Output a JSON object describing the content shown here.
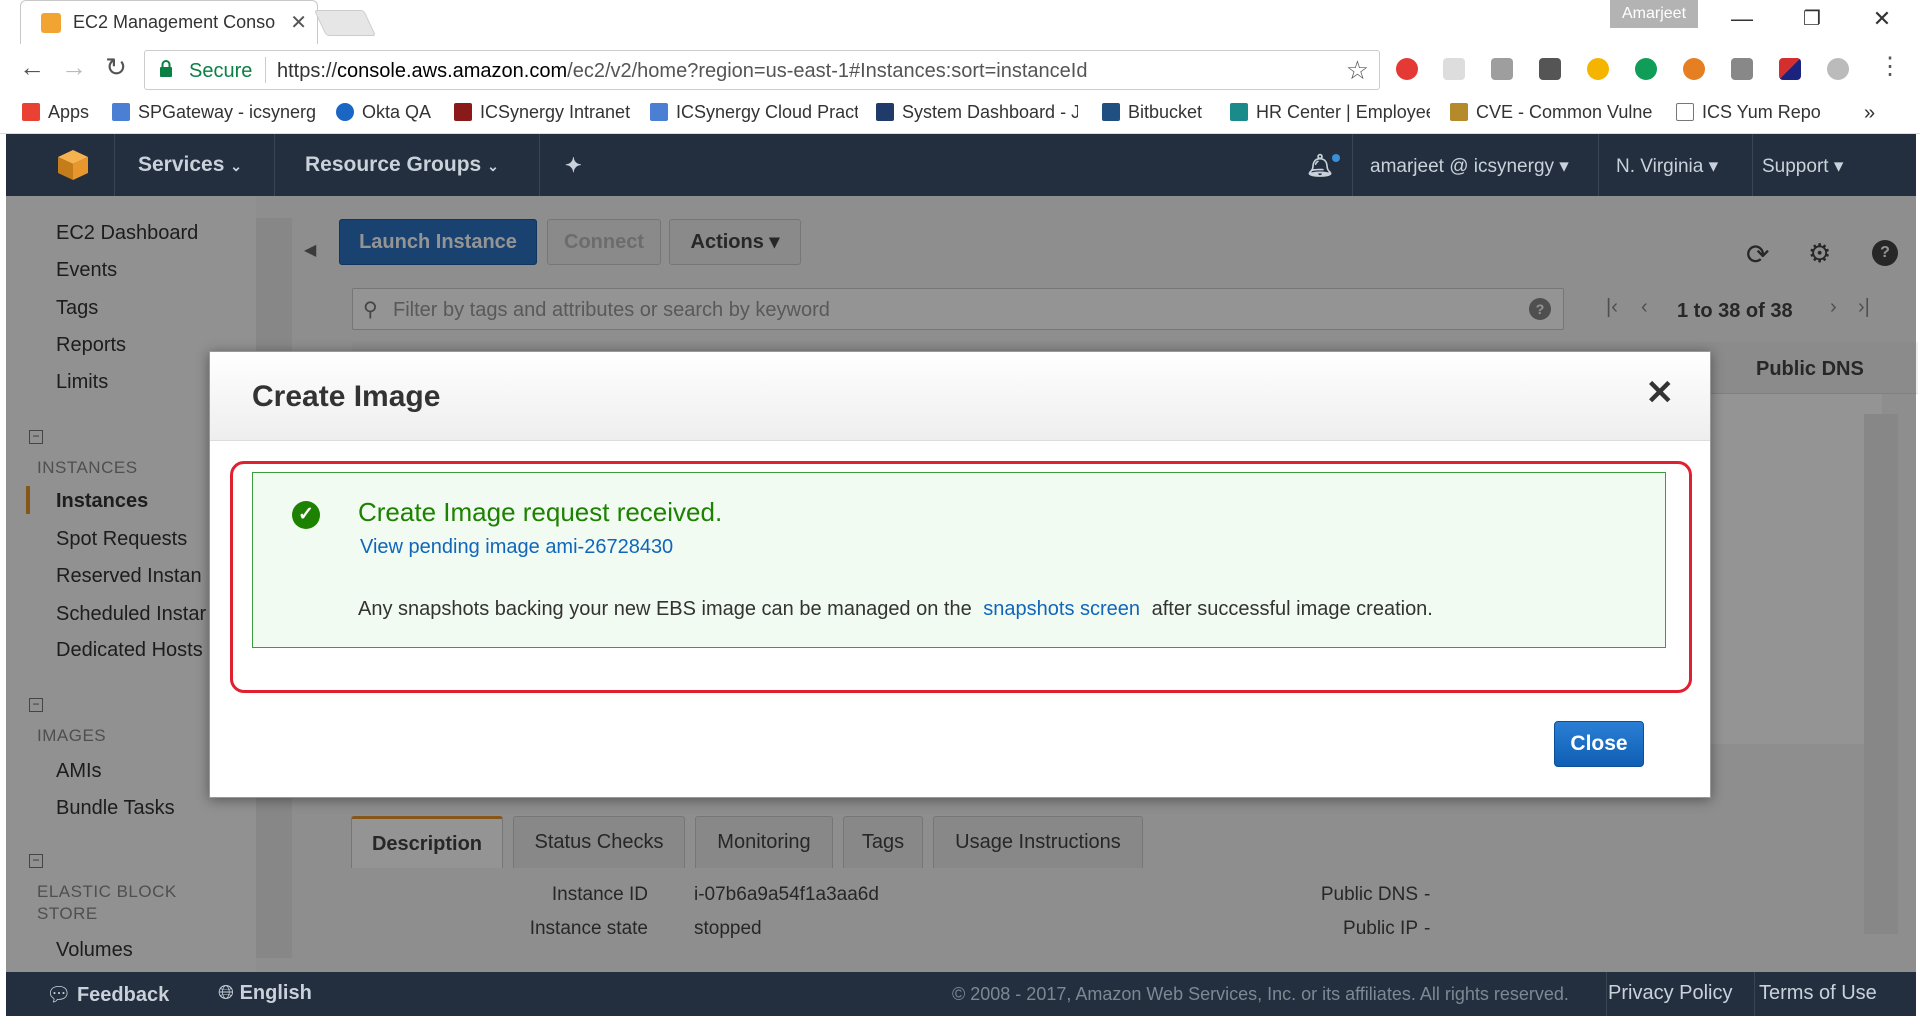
{
  "browser": {
    "tab_title": "EC2 Management Conso",
    "profile_name": "Amarjeet",
    "secure_label": "Secure",
    "url_scheme": "https://",
    "url_host": "console.aws.amazon.com",
    "url_path": "/ec2/v2/home?region=us-east-1#Instances:sort=instanceId"
  },
  "bookmarks": [
    {
      "label": "Apps",
      "color": "#e94235"
    },
    {
      "label": "SPGateway - icsynerg",
      "color": "#4a7fd4"
    },
    {
      "label": "Okta QA",
      "color": "#1a66c4"
    },
    {
      "label": "ICSynergy Intranet",
      "color": "#8a1a1a"
    },
    {
      "label": "ICSynergy Cloud Pract",
      "color": "#4a7fd4"
    },
    {
      "label": "System Dashboard - J",
      "color": "#203a6a"
    },
    {
      "label": "Bitbucket",
      "color": "#205081"
    },
    {
      "label": "HR Center | Employee",
      "color": "#1a8a8a"
    },
    {
      "label": "CVE - Common Vulne",
      "color": "#b58a2a"
    },
    {
      "label": "ICS Yum Repo",
      "color": "#777777"
    }
  ],
  "aws_header": {
    "services": "Services",
    "resource_groups": "Resource Groups",
    "user": "amarjeet @ icsynergy",
    "region": "N. Virginia",
    "support": "Support"
  },
  "sidebar": {
    "top_items": [
      "EC2 Dashboard",
      "Events",
      "Tags",
      "Reports",
      "Limits"
    ],
    "instances_heading": "INSTANCES",
    "instances_items": [
      "Instances",
      "Spot Requests",
      "Reserved Instan",
      "Scheduled Instar",
      "Dedicated Hosts"
    ],
    "images_heading": "IMAGES",
    "images_items": [
      "AMIs",
      "Bundle Tasks"
    ],
    "ebs_heading_line1": "ELASTIC BLOCK",
    "ebs_heading_line2": "STORE",
    "ebs_items": [
      "Volumes"
    ]
  },
  "toolbar": {
    "launch": "Launch Instance",
    "connect": "Connect",
    "actions": "Actions",
    "filter_placeholder": "Filter by tags and attributes or search by keyword",
    "pagination": "1 to 38 of 38",
    "col_public_dns": "Public DNS"
  },
  "details": {
    "tabs": [
      "Description",
      "Status Checks",
      "Monitoring",
      "Tags",
      "Usage Instructions"
    ],
    "instance_id_label": "Instance ID",
    "instance_id": "i-07b6a9a54f1a3aa6d",
    "instance_state_label": "Instance state",
    "instance_state": "stopped",
    "public_dns_label": "Public DNS",
    "public_dns": "-",
    "public_ip_label": "Public IP",
    "public_ip": "-"
  },
  "modal": {
    "title": "Create Image",
    "success_message": "Create Image request received.",
    "pending_link": "View pending image ami-26728430",
    "note_before": "Any snapshots backing your new EBS image can be managed on the",
    "note_link": "snapshots screen",
    "note_after": "after successful image creation.",
    "close_label": "Close"
  },
  "footer": {
    "feedback": "Feedback",
    "language": "English",
    "copyright": "© 2008 - 2017, Amazon Web Services, Inc. or its affiliates. All rights reserved.",
    "privacy": "Privacy Policy",
    "terms": "Terms of Use"
  }
}
